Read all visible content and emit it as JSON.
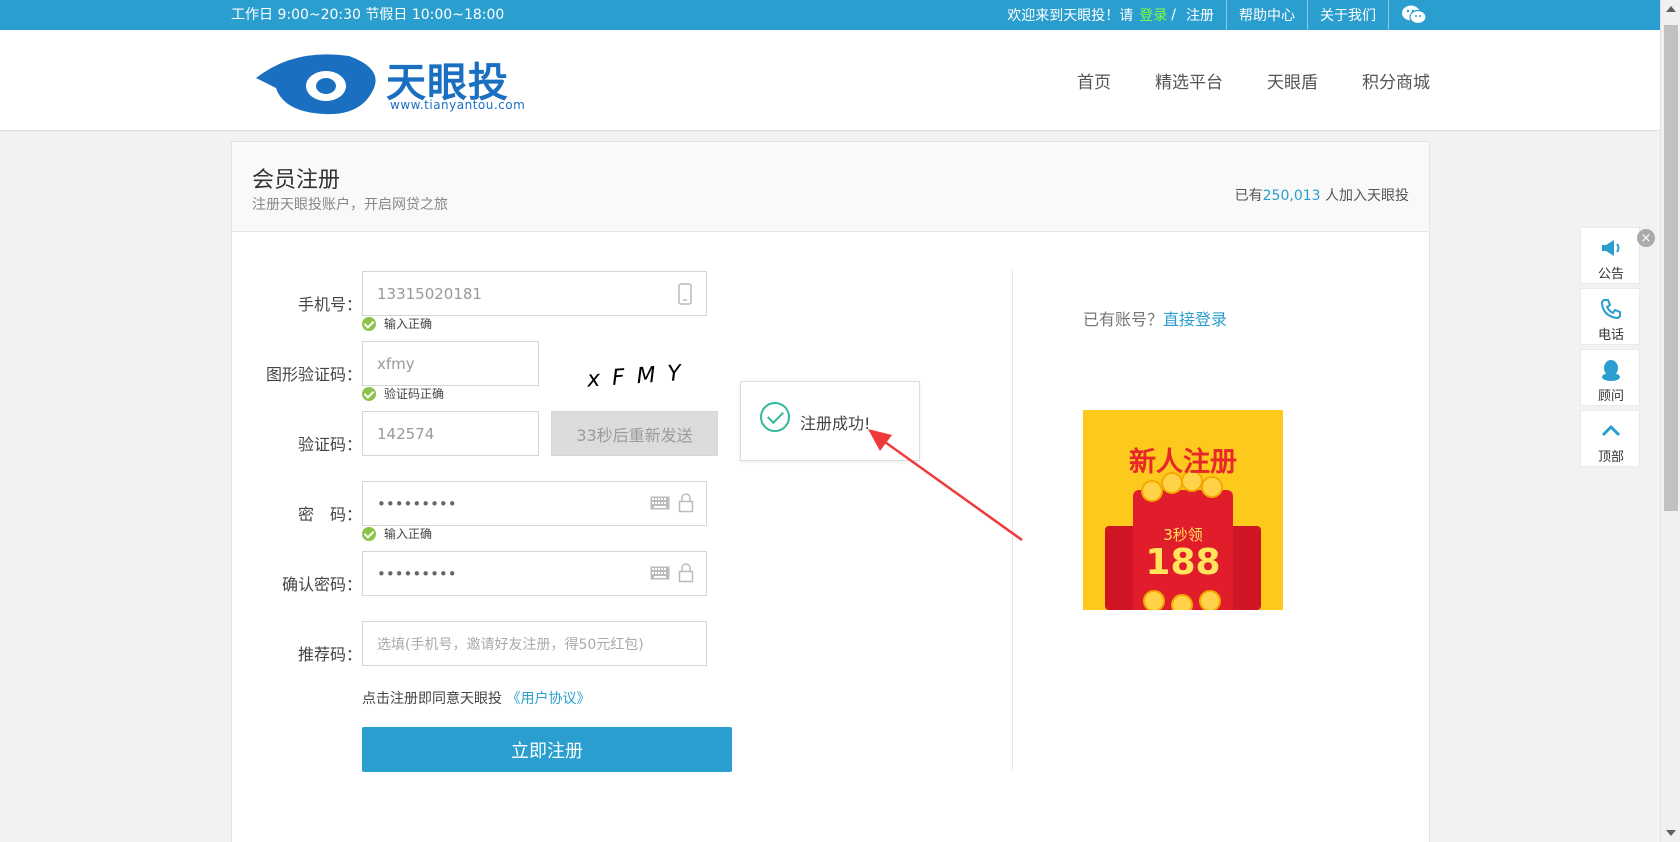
{
  "topbar": {
    "hours": "工作日 9:00~20:30  节假日 10:00~18:00",
    "welcome": "欢迎来到天眼投！请",
    "login": "登录",
    "slash": "/",
    "register": "注册",
    "help": "帮助中心",
    "about": "关于我们",
    "wechat_icon": "wechat-icon"
  },
  "header": {
    "brand": "天眼投",
    "url": "www.tianyantou.com",
    "nav": [
      "首页",
      "精选平台",
      "天眼盾",
      "积分商城"
    ]
  },
  "card": {
    "title": "会员注册",
    "subtitle": "注册天眼投账户，开启网贷之旅",
    "count_prefix": "已有",
    "count_number": "250,013",
    "count_suffix": " 人加入天眼投"
  },
  "form": {
    "phone": {
      "label": "手机号：",
      "value": "13315020181",
      "status": "输入正确"
    },
    "captcha": {
      "label": "图形验证码：",
      "value": "xfmy",
      "image_text": "xFMY",
      "status": "验证码正确"
    },
    "sms": {
      "label": "验证码：",
      "value": "142574",
      "resend": "33秒后重新发送"
    },
    "password": {
      "label": "密　码：",
      "value": "•••••••••",
      "status": "输入正确"
    },
    "confirm": {
      "label": "确认密码：",
      "value": "•••••••••"
    },
    "referral": {
      "label": "推荐码：",
      "placeholder": "选填(手机号，邀请好友注册，得50元红包)"
    },
    "agree_text": "点击注册即同意天眼投",
    "agree_link": "《用户协议》",
    "submit": "立即注册"
  },
  "side": {
    "has_account": "已有账号？",
    "login_link": "直接登录",
    "promo_title": "新人注册",
    "promo_seconds": "3秒领",
    "promo_amount": "188"
  },
  "popup": {
    "message": "注册成功!"
  },
  "float_bar": {
    "close": "×",
    "items": [
      {
        "label": "公告",
        "icon": "megaphone-icon"
      },
      {
        "label": "电话",
        "icon": "phone-icon"
      },
      {
        "label": "顾问",
        "icon": "qq-icon"
      },
      {
        "label": "顶部",
        "icon": "chevron-up-icon"
      }
    ]
  },
  "colors": {
    "accent": "#2a9fcf",
    "success": "#8bc34a",
    "promo_red": "#e21d2b"
  }
}
